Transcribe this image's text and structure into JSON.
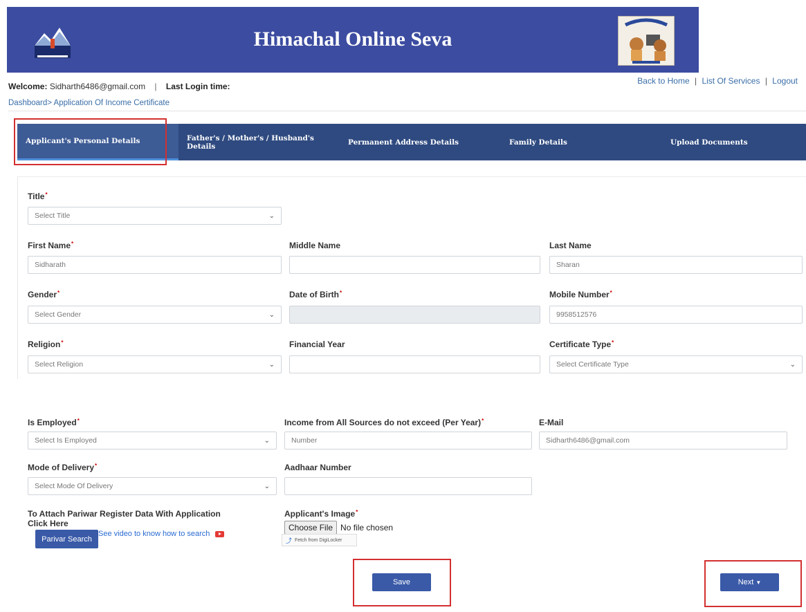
{
  "header": {
    "title": "Himachal Online Seva"
  },
  "welcome": {
    "label": "Welcome:",
    "email": "Sidharth6486@gmail.com",
    "separator": "|",
    "last_login_label": "Last Login time:"
  },
  "toplinks": {
    "home": "Back to Home",
    "services": "List Of Services",
    "logout": "Logout",
    "bar": "|"
  },
  "breadcrumb": "Dashboard> Application Of Income Certificate",
  "tabs": [
    "Applicant's Personal Details",
    "Father's / Mother's / Husband's Details",
    "Permanent Address Details",
    "Family Details",
    "Upload Documents"
  ],
  "form": {
    "title": {
      "label": "Title",
      "value": "Select Title"
    },
    "first_name": {
      "label": "First Name",
      "value": "Sidharath"
    },
    "middle_name": {
      "label": "Middle Name",
      "value": ""
    },
    "last_name": {
      "label": "Last Name",
      "value": "Sharan"
    },
    "gender": {
      "label": "Gender",
      "value": "Select Gender"
    },
    "dob": {
      "label": "Date of Birth",
      "value": ""
    },
    "mobile": {
      "label": "Mobile Number",
      "value": "9958512576"
    },
    "religion": {
      "label": "Religion",
      "value": "Select Religion"
    },
    "financial_year": {
      "label": "Financial Year",
      "value": ""
    },
    "certificate_type": {
      "label": "Certificate Type",
      "value": "Select Certificate Type"
    },
    "employed": {
      "label": "Is Employed",
      "value": "Select Is Employed"
    },
    "income": {
      "label": "Income from All Sources do not exceed (Per Year)",
      "placeholder": "Number"
    },
    "email": {
      "label": "E-Mail",
      "value": "Sidharth6486@gmail.com"
    },
    "delivery": {
      "label": "Mode of Delivery",
      "value": "Select Mode Of Delivery"
    },
    "aadhaar": {
      "label": "Aadhaar Number",
      "value": ""
    },
    "pariwar": {
      "line1": "To Attach Pariwar Register Data With Application",
      "line2": "Click Here",
      "button": "Parivar Search",
      "video_link": "See video to know how to search"
    },
    "image": {
      "label": "Applicant's Image",
      "choose": "Choose File",
      "no_file": "No file chosen",
      "digilocker": "Fetch from DigiLocker"
    }
  },
  "buttons": {
    "save": "Save",
    "next": "Next"
  },
  "colors": {
    "header": "#3c4ca0",
    "tabs": "#2f4a80",
    "button": "#3a5aa8",
    "highlight": "#d32f2f"
  }
}
